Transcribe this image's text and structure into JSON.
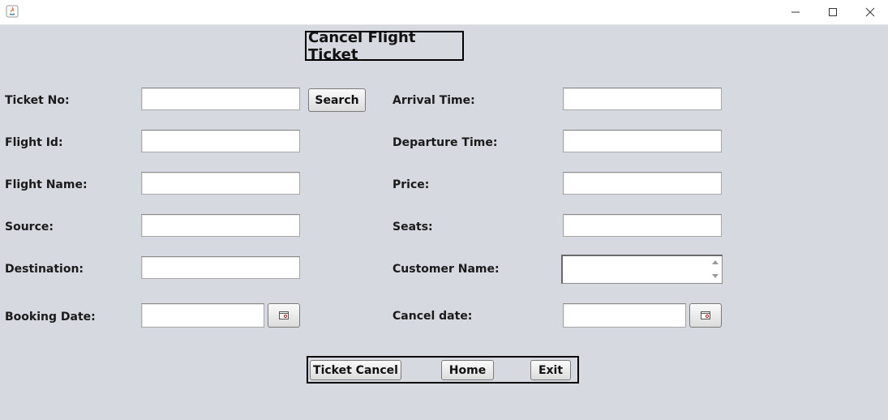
{
  "window": {
    "app_icon": "java-icon",
    "controls": [
      "minimize-icon",
      "maximize-icon",
      "close-icon"
    ]
  },
  "form": {
    "title": "Cancel Flight Ticket",
    "left": {
      "ticket_no": {
        "label": "Ticket No:",
        "value": ""
      },
      "flight_id": {
        "label": "Flight Id:",
        "value": ""
      },
      "flight_name": {
        "label": "Flight Name:",
        "value": ""
      },
      "source": {
        "label": "Source:",
        "value": ""
      },
      "destination": {
        "label": "Destination:",
        "value": ""
      },
      "booking_date": {
        "label": "Booking Date:",
        "value": ""
      }
    },
    "right": {
      "arrival_time": {
        "label": "Arrival Time:",
        "value": ""
      },
      "departure_time": {
        "label": "Departure Time:",
        "value": ""
      },
      "price": {
        "label": "Price:",
        "value": ""
      },
      "seats": {
        "label": "Seats:",
        "value": ""
      },
      "customer_name": {
        "label": "Customer Name:",
        "value": ""
      },
      "cancel_date": {
        "label": "Cancel date:",
        "value": ""
      }
    },
    "search_label": "Search",
    "calendar_icon": "calendar-icon"
  },
  "actions": {
    "ticket_cancel": "Ticket Cancel",
    "home": "Home",
    "exit": "Exit"
  },
  "colors": {
    "background": "#d6d9e0",
    "field": "#ffffff",
    "border": "#000000"
  }
}
